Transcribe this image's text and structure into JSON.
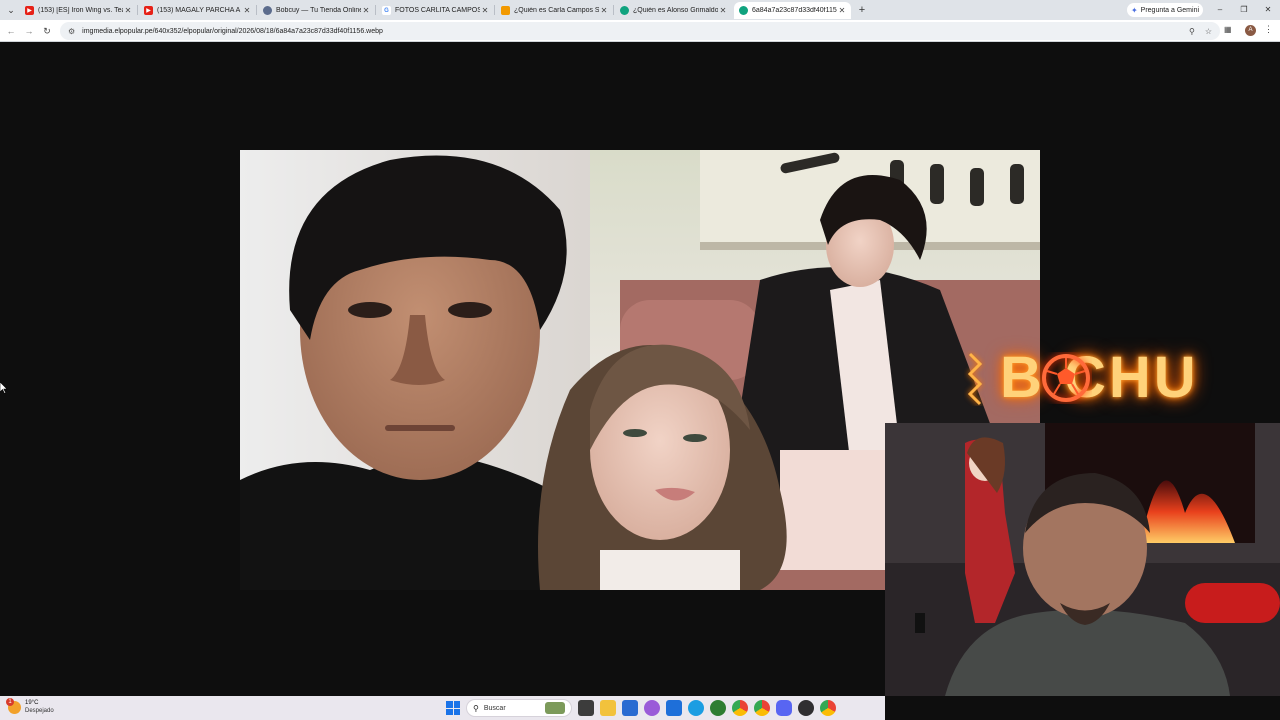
{
  "browser": {
    "tabs": [
      {
        "title": "(153) [ES] Iron Wing vs. Team S",
        "favicon": "youtube-icon",
        "color": "#e62117"
      },
      {
        "title": "(153) MAGALY PARCHA A CURI",
        "favicon": "youtube-icon",
        "color": "#e62117"
      },
      {
        "title": "Bobcuy — Tu Tienda Online de",
        "favicon": "globe-icon",
        "color": "#5b6b8c"
      },
      {
        "title": "FOTOS CARLITA CAMPOS SALA",
        "favicon": "google-icon",
        "color": "#4285f4"
      },
      {
        "title": "¿Quién es Carla Campos Salaza",
        "favicon": "bookmark-icon",
        "color": "#f29900"
      },
      {
        "title": "¿Quién es Alonso Grimaldo, el",
        "favicon": "chatgpt-icon",
        "color": "#10a37f"
      },
      {
        "title": "6a84a7a23c87d33df40f1156.we",
        "favicon": "chatgpt-icon",
        "color": "#10a37f"
      }
    ],
    "active_tab_index": 6,
    "gemini_label": "Pregunta a Gemini",
    "url": "imgmedia.elpopular.pe/640x352/elpopular/original/2026/08/18/6a84a7a23c87d33df40f1156.webp",
    "profile_initial": "A"
  },
  "overlay": {
    "brand_text": "B  CHU",
    "brand_color": "#ffd27a",
    "glow_color": "#ff7a00"
  },
  "taskbar": {
    "weather_temp": "19°C",
    "weather_desc": "Despejado",
    "weather_alert": "1",
    "search_label": "Buscar",
    "pinned_icons": [
      "task-view-icon",
      "file-explorer-icon",
      "store-icon",
      "copilot-icon",
      "mail-icon",
      "edge-icon",
      "xbox-icon",
      "chrome-icon",
      "chrome-icon",
      "discord-icon",
      "obs-icon",
      "chrome-icon"
    ]
  }
}
